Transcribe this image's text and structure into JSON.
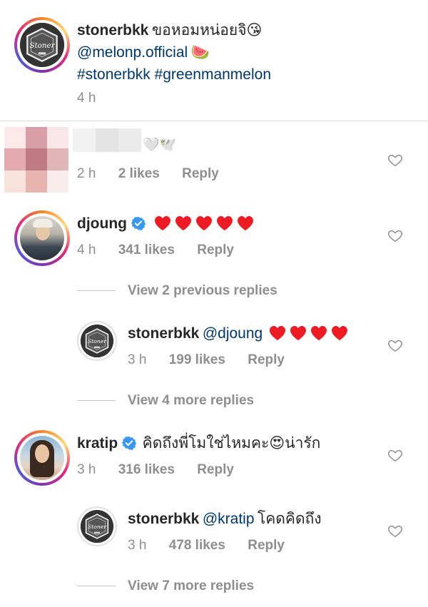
{
  "post": {
    "username": "stonerbkk",
    "caption": "ขอหอมหน่อยจิ",
    "caption_emoji": "😘",
    "mention": "@melonp.official",
    "mention_emoji": "🍉",
    "hashtags": "#stonerbkk #greenmanmelon",
    "time": "4 h"
  },
  "comments": [
    {
      "id": "blurred",
      "username": "",
      "text_emoji": "🤍🕊️",
      "time": "2 h",
      "likes": "2 likes",
      "reply_label": "Reply"
    },
    {
      "id": "djoung",
      "username": "djoung",
      "verified": true,
      "hearts": 5,
      "time": "4 h",
      "likes": "341 likes",
      "reply_label": "Reply",
      "view_replies": "View 2 previous replies",
      "replies": [
        {
          "username": "stonerbkk",
          "mention": "@djoung",
          "hearts": 4,
          "time": "3 h",
          "likes": "199 likes",
          "reply_label": "Reply"
        }
      ],
      "view_more": "View 4 more replies"
    },
    {
      "id": "kratip",
      "username": "kratip",
      "verified": true,
      "text": "คิดถึงพี่โมใช่ไหมคะ",
      "emoji": "😍",
      "text_after": "น่ารัก",
      "time": "3 h",
      "likes": "316 likes",
      "reply_label": "Reply",
      "replies": [
        {
          "username": "stonerbkk",
          "mention": "@kratip",
          "text": "โคดคิดถึง",
          "time": "3 h",
          "likes": "478 likes",
          "reply_label": "Reply"
        }
      ],
      "view_more": "View 7 more replies"
    }
  ],
  "logo_text": "Stoner",
  "colors": {
    "mention": "#00376b",
    "meta": "#8e8e8e",
    "heart_red": "#ed1c24",
    "verified": "#3897f0"
  }
}
